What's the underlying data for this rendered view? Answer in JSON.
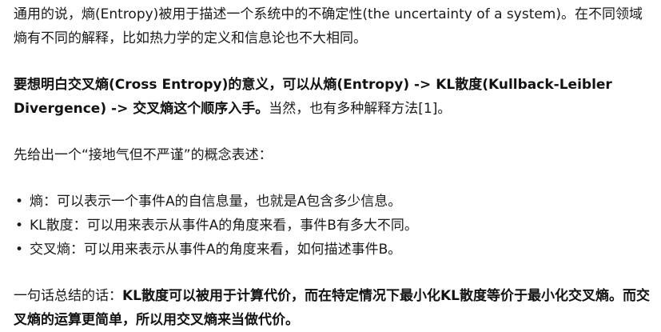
{
  "paragraph1": {
    "text": "通用的说，熵(Entropy)被用于描述一个系统中的不确定性(the uncertainty of a system)。在不同领域熵有不同的解释，比如热力学的定义和信息论也不大相同。"
  },
  "paragraph2": {
    "bold": "要想明白交叉熵(Cross Entropy)的意义，可以从熵(Entropy) -> KL散度(Kullback-Leibler Divergence) -> 交叉熵这个顺序入手。",
    "normal": "当然，也有多种解释方法[1]。"
  },
  "paragraph3": {
    "text": "先给出一个“接地气但不严谨”的概念表述："
  },
  "bullets": [
    {
      "marker": "•",
      "text": "熵：可以表示一个事件A的自信息量，也就是A包含多少信息。"
    },
    {
      "marker": "•",
      "text": "KL散度：可以用来表示从事件A的角度来看，事件B有多大不同。"
    },
    {
      "marker": "•",
      "text": "交叉熵：可以用来表示从事件A的角度来看，如何描述事件B。"
    }
  ],
  "paragraph4": {
    "normal": "一句话总结的话：",
    "bold": "KL散度可以被用于计算代价，而在特定情况下最小化KL散度等价于最小化交叉熵。而交叉熵的运算更简单，所以用交叉熵来当做代价。"
  }
}
